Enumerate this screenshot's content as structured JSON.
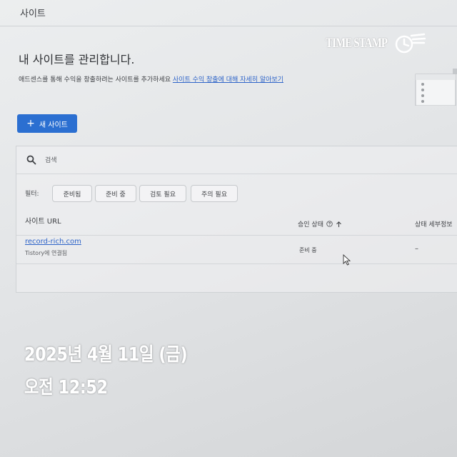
{
  "header": {
    "title": "사이트"
  },
  "main": {
    "title": "내 사이트를 관리합니다.",
    "description": "애드센스를 통해 수익을 창출하려는 사이트를 추가하세요",
    "learn_more_link": "사이트 수익 창출에 대해 자세히 알아보기",
    "new_site_button": "새 사이트"
  },
  "search": {
    "placeholder": "검색"
  },
  "filters": {
    "label": "필터:",
    "chips": [
      "준비됨",
      "준비 중",
      "검토 필요",
      "주의 필요"
    ]
  },
  "table": {
    "columns": [
      "사이트 URL",
      "승인 상태",
      "상태 세부정보"
    ],
    "rows": [
      {
        "url": "record-rich.com",
        "sub": "Tistory에 연결됨",
        "status": "준비 중",
        "detail": "–"
      }
    ]
  },
  "overlay": {
    "stamp_text": "TIME STAMP",
    "date": "2025년 4월 11일 (금)",
    "time": "오전 12:52"
  },
  "icons": {
    "search": "search-icon",
    "help": "help-circle-icon",
    "sort": "arrow-up-icon",
    "add": "plus-icon",
    "clock": "clock-icon",
    "cursor": "mouse-pointer-icon"
  },
  "colors": {
    "accent": "#2b6fd1",
    "link": "#2d63c8"
  }
}
